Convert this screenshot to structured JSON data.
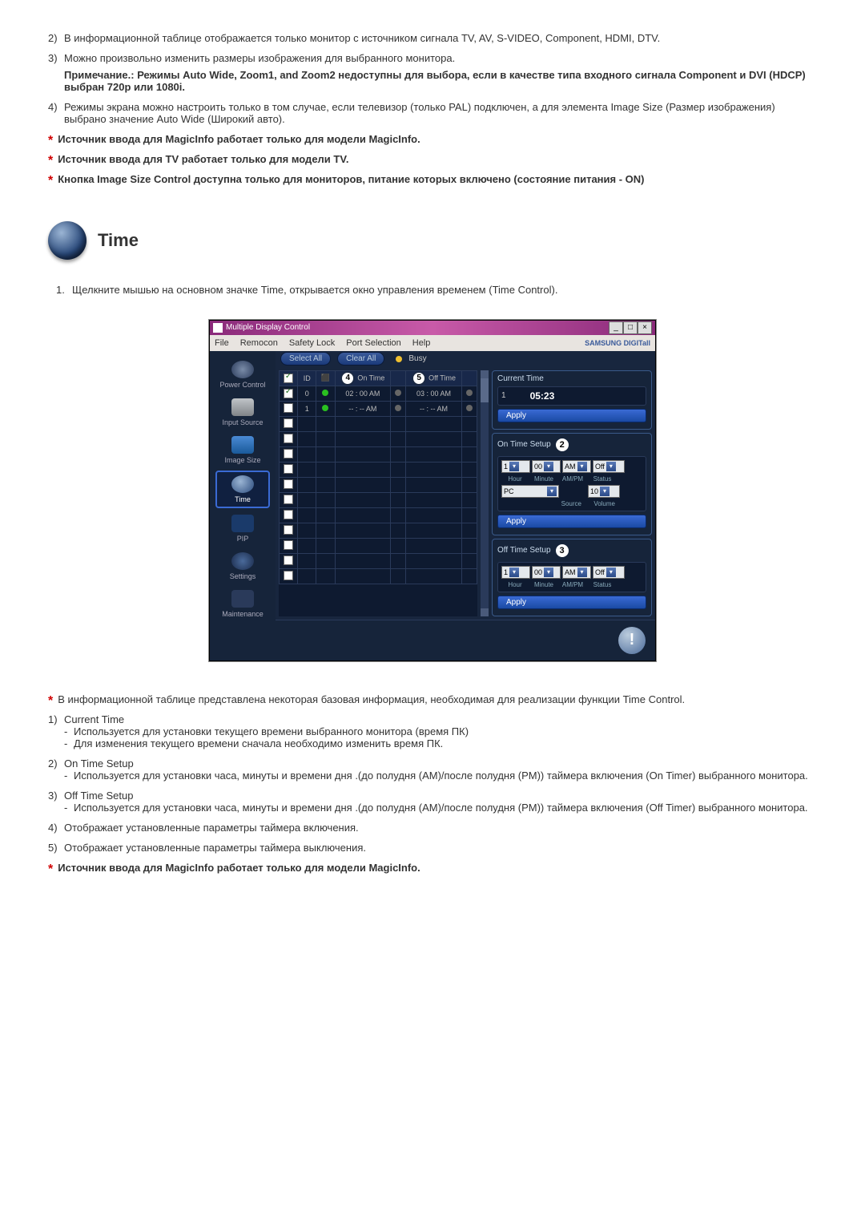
{
  "top_list": {
    "i2": {
      "n": "2)",
      "t": "В информационной таблице отображается только монитор с источником сигнала TV, AV, S-VIDEO, Component, HDMI, DTV."
    },
    "i3": {
      "n": "3)",
      "t": "Можно произвольно изменить размеры изображения для выбранного монитора.",
      "note": "Примечание.: Режимы Auto Wide, Zoom1, and Zoom2 недоступны для выбора, если в качестве типа входного сигнала Component и DVI (HDCP) выбран 720p или 1080i."
    },
    "i4": {
      "n": "4)",
      "t": "Режимы экрана можно настроить только в том случае, если телевизор (только PAL) подключен, а для элемента Image Size (Размер изображения) выбрано значение Auto Wide (Широкий авто)."
    }
  },
  "top_stars": {
    "s1": "Источник ввода для MagicInfo работает только для модели MagicInfo.",
    "s2": "Источник ввода для TV работает только для модели TV.",
    "s3": "Кнопка Image Size Control доступна только для мониторов, питание которых включено (состояние питания - ON)"
  },
  "head_title": "Time",
  "intro": {
    "n": "1.",
    "t": "Щелкните мышью на основном значке Time, открывается окно управления временем (Time Control)."
  },
  "app": {
    "title": "Multiple Display Control",
    "menu": {
      "file": "File",
      "remocon": "Remocon",
      "safety": "Safety Lock",
      "port": "Port Selection",
      "help": "Help",
      "brand": "SAMSUNG DIGITall"
    },
    "sidebar": {
      "power": "Power Control",
      "input": "Input Source",
      "image": "Image Size",
      "time": "Time",
      "pip": "PIP",
      "settings": "Settings",
      "maint": "Maintenance"
    },
    "topbar": {
      "select_all": "Select All",
      "clear_all": "Clear All",
      "busy": "Busy"
    },
    "grid": {
      "hdr": {
        "c1": "",
        "c2": "ID",
        "c3": "",
        "c4": "On Time",
        "c5": "",
        "c6": "Off Time",
        "c7": ""
      },
      "badge4": "4",
      "badge5": "5",
      "r1": {
        "id": "0",
        "on": "02 : 00 AM",
        "off": "03 : 00 AM"
      },
      "r2": {
        "id": "1",
        "on": "-- : -- AM",
        "off": "-- : -- AM"
      }
    },
    "current": {
      "title": "Current Time",
      "badge": "1",
      "value": "05:23",
      "apply": "Apply"
    },
    "ontime": {
      "title": "On Time Setup",
      "badge": "2",
      "hour": "1",
      "minute": "00",
      "ampm": "AM",
      "status": "Off",
      "source": "PC",
      "volume": "10",
      "lbl_hour": "Hour",
      "lbl_min": "Minute",
      "lbl_ampm": "AM/PM",
      "lbl_status": "Status",
      "lbl_source": "Source",
      "lbl_vol": "Volume",
      "apply": "Apply"
    },
    "offtime": {
      "title": "Off Time Setup",
      "badge": "3",
      "hour": "1",
      "minute": "00",
      "ampm": "AM",
      "status": "Off",
      "lbl_hour": "Hour",
      "lbl_min": "Minute",
      "lbl_ampm": "AM/PM",
      "lbl_status": "Status",
      "apply": "Apply"
    }
  },
  "after_star": "В информационной таблице представлена некоторая базовая информация, необходимая для реализации функции Time Control.",
  "desc": {
    "i1": {
      "n": "1)",
      "t": "Current Time",
      "a": "Используется для установки текущего времени выбранного монитора (время ПК)",
      "b": "Для изменения текущего времени сначала необходимо изменить время ПК."
    },
    "i2": {
      "n": "2)",
      "t": "On Time Setup",
      "a": "Используется для установки часа, минуты и времени дня .(до полудня (AM)/после полудня (PM)) таймера включения (On Timer) выбранного монитора."
    },
    "i3": {
      "n": "3)",
      "t": "Off Time Setup",
      "a": "Используется для установки часа, минуты и времени дня .(до полудня (AM)/после полудня (PM)) таймера включения (Off Timer) выбранного монитора."
    },
    "i4": {
      "n": "4)",
      "t": "Отображает установленные параметры таймера включения."
    },
    "i5": {
      "n": "5)",
      "t": "Отображает установленные параметры таймера выключения."
    }
  },
  "bottom_star": "Источник ввода для MagicInfo работает только для модели MagicInfo."
}
